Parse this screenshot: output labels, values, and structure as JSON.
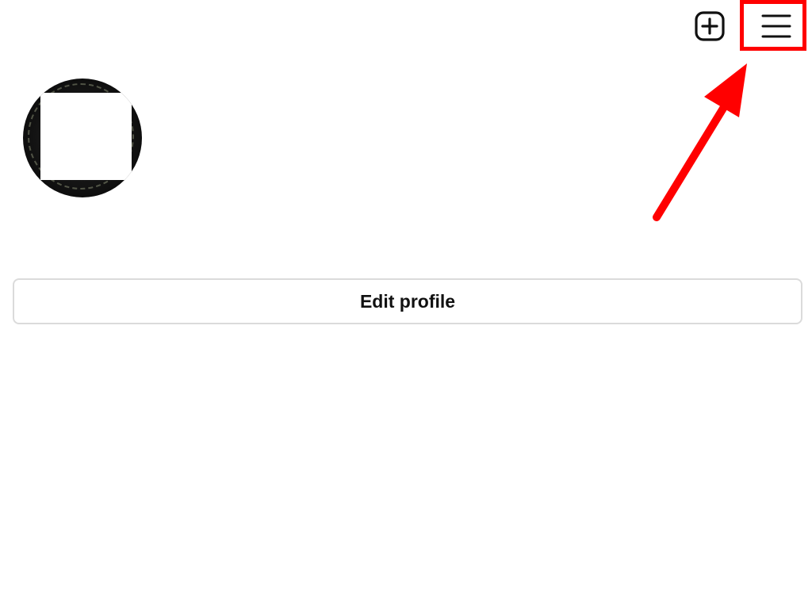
{
  "header": {
    "new_post_icon": "plus-square-icon",
    "menu_icon": "hamburger-menu-icon"
  },
  "annotation": {
    "highlight_color": "#ff0000",
    "arrow_color": "#ff0000",
    "target": "menu-button"
  },
  "profile": {
    "edit_button_label": "Edit profile"
  }
}
